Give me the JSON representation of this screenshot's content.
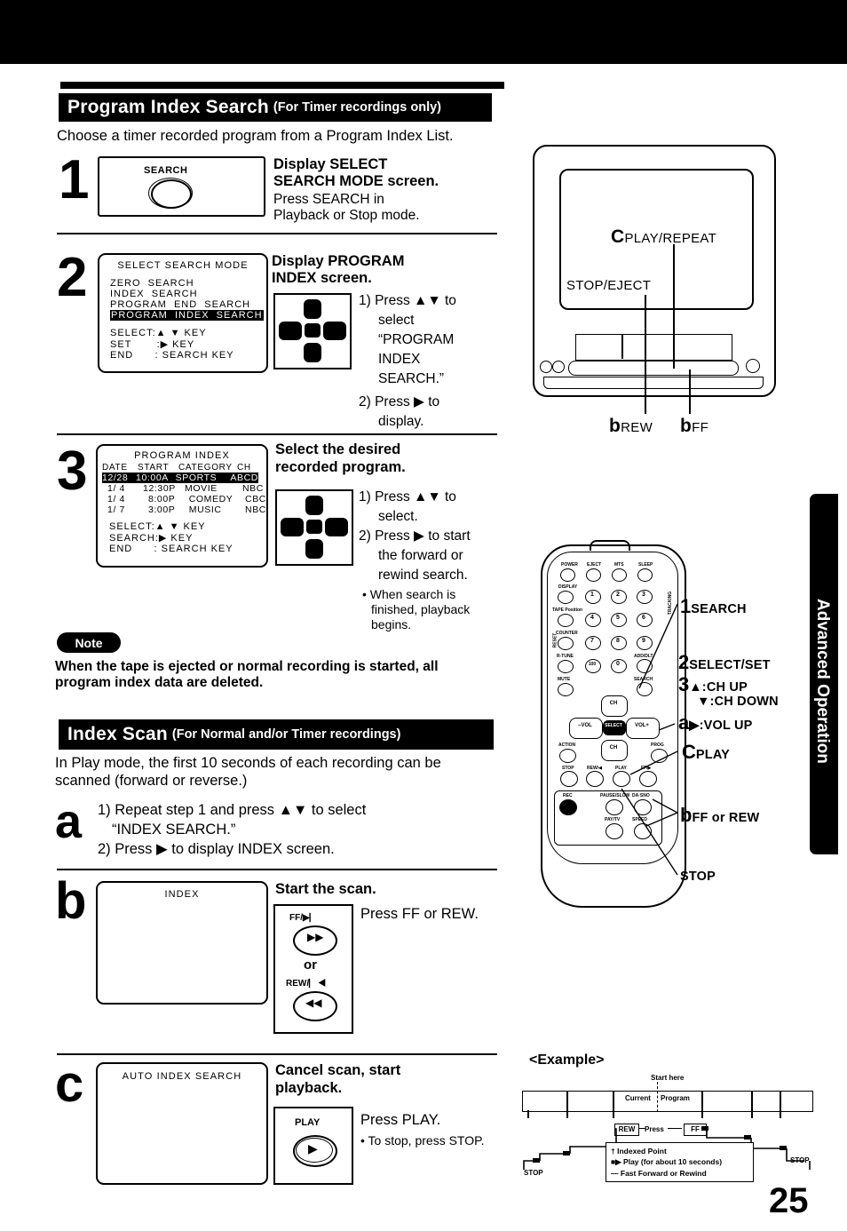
{
  "page": {
    "number": "25",
    "side_tab": "Advanced Operation"
  },
  "section1": {
    "title": "Program Index Search",
    "subtitle": "(For Timer recordings only)",
    "intro": "Choose a timer recorded program from a Program Index List.",
    "steps": [
      {
        "num": "1",
        "button_label": "SEARCH",
        "heading_line1": "Display SELECT",
        "heading_line2": "SEARCH MODE screen.",
        "body_line1": "Press SEARCH in",
        "body_line2": "Playback or Stop mode."
      },
      {
        "num": "2",
        "heading_line1": "Display PROGRAM",
        "heading_line2": "INDEX screen.",
        "body": [
          "1) Press ▲▼ to",
          "select",
          "“PROGRAM",
          "INDEX",
          "SEARCH.”",
          "2) Press ▶ to",
          "display."
        ],
        "osd": {
          "title": "SELECT SEARCH MODE",
          "items": [
            "ZERO  SEARCH",
            "INDEX  SEARCH",
            "PROGRAM  END  SEARCH"
          ],
          "highlighted": "PROGRAM  INDEX  SEARCH",
          "keys": [
            "SELECT:▲ ▼ KEY",
            "SET       :▶ KEY",
            "END      : SEARCH KEY"
          ]
        }
      },
      {
        "num": "3",
        "heading_line1": "Select the desired",
        "heading_line2": "recorded program.",
        "body": [
          "1) Press ▲▼ to",
          "select.",
          "2) Press ▶ to start",
          "the forward or",
          "rewind search."
        ],
        "bullet": [
          "• When search is",
          "finished, playback",
          "begins."
        ],
        "osd": {
          "title": "PROGRAM  INDEX",
          "columns": [
            "DATE",
            "START",
            "CATEGORY",
            "CH"
          ],
          "rows": [
            {
              "date": "12/28",
              "start": "10:00A",
              "category": "SPORTS",
              "ch": "ABCD",
              "selected": true
            },
            {
              "date": "1/ 4",
              "start": "12:30P",
              "category": "MOVIE",
              "ch": "NBC",
              "selected": false
            },
            {
              "date": "1/ 4",
              "start": "8:00P",
              "category": "COMEDY",
              "ch": "CBC",
              "selected": false
            },
            {
              "date": "1/ 7",
              "start": "3:00P",
              "category": "MUSIC",
              "ch": "NBC",
              "selected": false
            }
          ],
          "keys": [
            "SELECT:▲ ▼ KEY",
            "SEARCH:▶ KEY",
            "END      : SEARCH KEY"
          ]
        }
      }
    ],
    "note": {
      "label": "Note",
      "line1": "When the tape is ejected or normal recording is started, all",
      "line2": "program index data are deleted."
    }
  },
  "section2": {
    "title": "Index Scan",
    "subtitle": "(For Normal and/or Timer recordings)",
    "intro_line1": "In Play mode, the first 10 seconds of each recording can be",
    "intro_line2": "scanned (forward or reverse.)",
    "steps": [
      {
        "num": "a",
        "body_line1": "1) Repeat step 1 and press ▲▼ to select",
        "body_line2": "“INDEX SEARCH.”",
        "body_line3": "2) Press ▶ to display INDEX screen."
      },
      {
        "num": "b",
        "osd_title": "INDEX",
        "heading": "Start the scan.",
        "body": "Press FF or REW.",
        "button_ff": "FF/",
        "button_or": "or",
        "button_rew": "REW/"
      },
      {
        "num": "c",
        "osd_title": "AUTO  INDEX  SEARCH",
        "heading_line1": "Cancel scan, start",
        "heading_line2": "playback.",
        "body": "Press PLAY.",
        "bullet": "• To stop, press STOP.",
        "button_play": "PLAY"
      }
    ]
  },
  "tv_illustration": {
    "callouts": [
      {
        "marker": "C",
        "text": "PLAY/REPEAT"
      },
      {
        "marker": "",
        "text": "STOP/EJECT"
      },
      {
        "marker": "b",
        "text": "REW"
      },
      {
        "marker": "b",
        "text": "FF"
      }
    ]
  },
  "remote": {
    "top_row": [
      "POWER",
      "EJECT",
      "MTS",
      "SLEEP"
    ],
    "left_column": [
      "DISPLAY",
      "TAPE Position",
      "COUNTER",
      "R-TUNE",
      "MUTE"
    ],
    "side_labels": [
      "RESET",
      "TRACKING"
    ],
    "keypad": [
      "1",
      "2",
      "3",
      "4",
      "5",
      "6",
      "7",
      "8",
      "9",
      "100",
      "0"
    ],
    "right_column": [
      "ADD/DLT",
      "SEARCH"
    ],
    "dpad": {
      "up": "CH",
      "down": "CH",
      "left": "–VOL",
      "right": "VOL+",
      "center": "SELECT"
    },
    "mid_row": [
      "ACTION",
      "PROG"
    ],
    "transport": [
      "STOP",
      "REW/",
      "PLAY",
      "FF/"
    ],
    "panel": [
      "REC",
      "PAUSE/SLOW",
      "DA·SNO",
      "PAY/TV",
      "SPEED"
    ],
    "callouts": [
      {
        "marker": "1",
        "text": "SEARCH"
      },
      {
        "marker": "2",
        "text": "SELECT/SET"
      },
      {
        "marker": "3",
        "text": "▲:CH UP"
      },
      {
        "marker": "",
        "text": "▼:CH DOWN"
      },
      {
        "marker": "a",
        "text": "▶:VOL UP"
      },
      {
        "marker": "C",
        "text": "PLAY"
      },
      {
        "marker": "b",
        "text": "FF or REW"
      },
      {
        "marker": "",
        "text": "STOP"
      }
    ]
  },
  "example": {
    "title": "<Example>",
    "start_here": "Start here",
    "current": "Current",
    "program": "Program",
    "press": "Press",
    "rew": "REW",
    "ff": "FF",
    "stop_left": "STOP",
    "stop_right": "STOP",
    "legend": [
      "Indexed Point",
      "Play (for about 10 seconds)",
      "Fast Forward or Rewind"
    ]
  }
}
